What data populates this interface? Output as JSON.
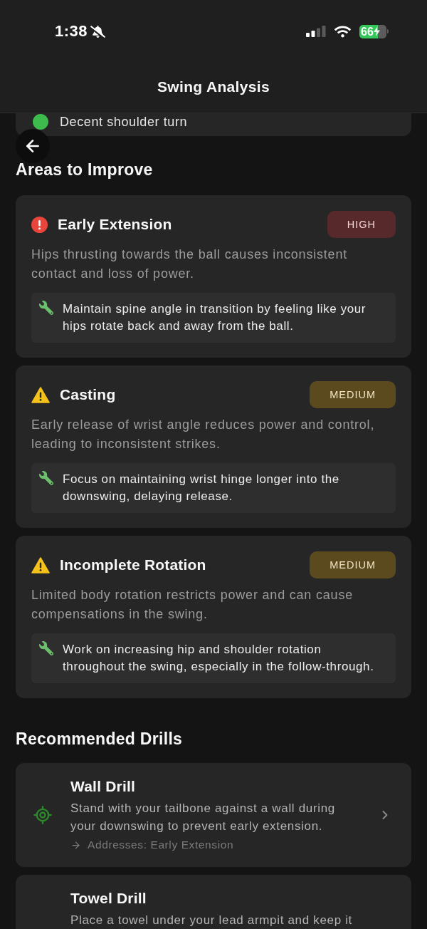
{
  "status_bar": {
    "time": "1:38",
    "battery": "66"
  },
  "header": {
    "title": "Swing Analysis"
  },
  "list_card": {
    "items": [
      {
        "text": "Decent shoulder turn"
      }
    ]
  },
  "areas_to_improve": {
    "title": "Areas to Improve",
    "issues": [
      {
        "kind": "error",
        "title": "Early Extension",
        "badge": "HIGH",
        "description": "Hips thrusting towards the ball causes inconsistent contact and loss of power.",
        "tip": "Maintain spine angle in transition by feeling like your hips rotate back and away from the ball."
      },
      {
        "kind": "warning",
        "title": "Casting",
        "badge": "MEDIUM",
        "description": "Early release of wrist angle reduces power and control, leading to inconsistent strikes.",
        "tip": "Focus on maintaining wrist hinge longer into the downswing, delaying release."
      },
      {
        "kind": "warning",
        "title": "Incomplete Rotation",
        "badge": "MEDIUM",
        "description": "Limited body rotation restricts power and can cause compensations in the swing.",
        "tip": "Work on increasing hip and shoulder rotation throughout the swing, especially in the follow-through."
      }
    ]
  },
  "recommended_drills": {
    "title": "Recommended Drills",
    "drills": [
      {
        "title": "Wall Drill",
        "description": "Stand with your tailbone against a wall during your downswing to prevent early extension.",
        "addresses": "Addresses: Early Extension",
        "navigable": true
      },
      {
        "title": "Towel Drill",
        "description": "Place a towel under your lead armpit and keep it"
      }
    ]
  }
}
